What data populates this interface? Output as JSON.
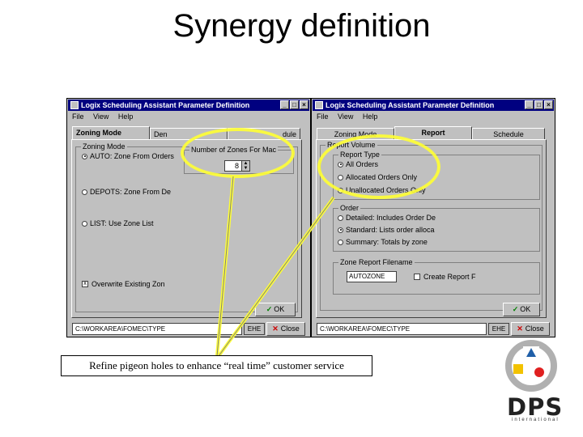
{
  "slide": {
    "title": "Synergy definition",
    "caption": "Refine pigeon holes to enhance “real time” customer service"
  },
  "window_a": {
    "title": "Logix Scheduling Assistant Parameter Definition",
    "menu": [
      "File",
      "View",
      "Help"
    ],
    "tabs": [
      "Zoning Mode",
      "Den",
      "dule"
    ],
    "zoning_group_label": "Zoning Mode",
    "radio_auto": "AUTO: Zone From Orders",
    "number_group_label": "Number of Zones For Mac",
    "number_value": "8",
    "radio_depots": "DEPOTS: Zone From De",
    "radio_list": "LIST: Use Zone List",
    "overwrite_label": "Overwrite Existing Zon",
    "ok_label": "OK",
    "status_path": "C:\\WORKAREA\\FOMEC\\TYPE",
    "status_right": "EHE",
    "close_label": "Close"
  },
  "window_b": {
    "title": "Logix Scheduling Assistant Parameter Definition",
    "menu": [
      "File",
      "View",
      "Help"
    ],
    "tabs": [
      "Zoning Mode",
      "Report",
      "Schedule"
    ],
    "outer_group_label": "Report Volume",
    "report_type_label": "Report Type",
    "rt_all": "All Orders",
    "rt_allocated": "Allocated Orders Only",
    "rt_unallocated": "Unallocated Orders Only",
    "order_group_label": "Order",
    "ord_detailed": "Detailed: Includes Order De",
    "ord_standard": "Standard: Lists order alloca",
    "ord_summary": "Summary: Totals by zone",
    "zone_report_label": "Zone Report Filename",
    "zone_report_value": "AUTOZONE",
    "create_report_label": "Create Report F",
    "ok_label": "OK",
    "status_path": "C:\\WORKAREA\\FOMEC\\TYPE",
    "status_right": "EHE",
    "close_label": "Close"
  },
  "logo": {
    "name": "DPS",
    "tagline": "international"
  },
  "colors": {
    "titlebar": "#000080",
    "window_face": "#c0c0c0",
    "highlight": "#ffff33",
    "logo_blue": "#1f5fa8",
    "logo_red": "#e02020",
    "logo_yellow": "#f2c200"
  }
}
